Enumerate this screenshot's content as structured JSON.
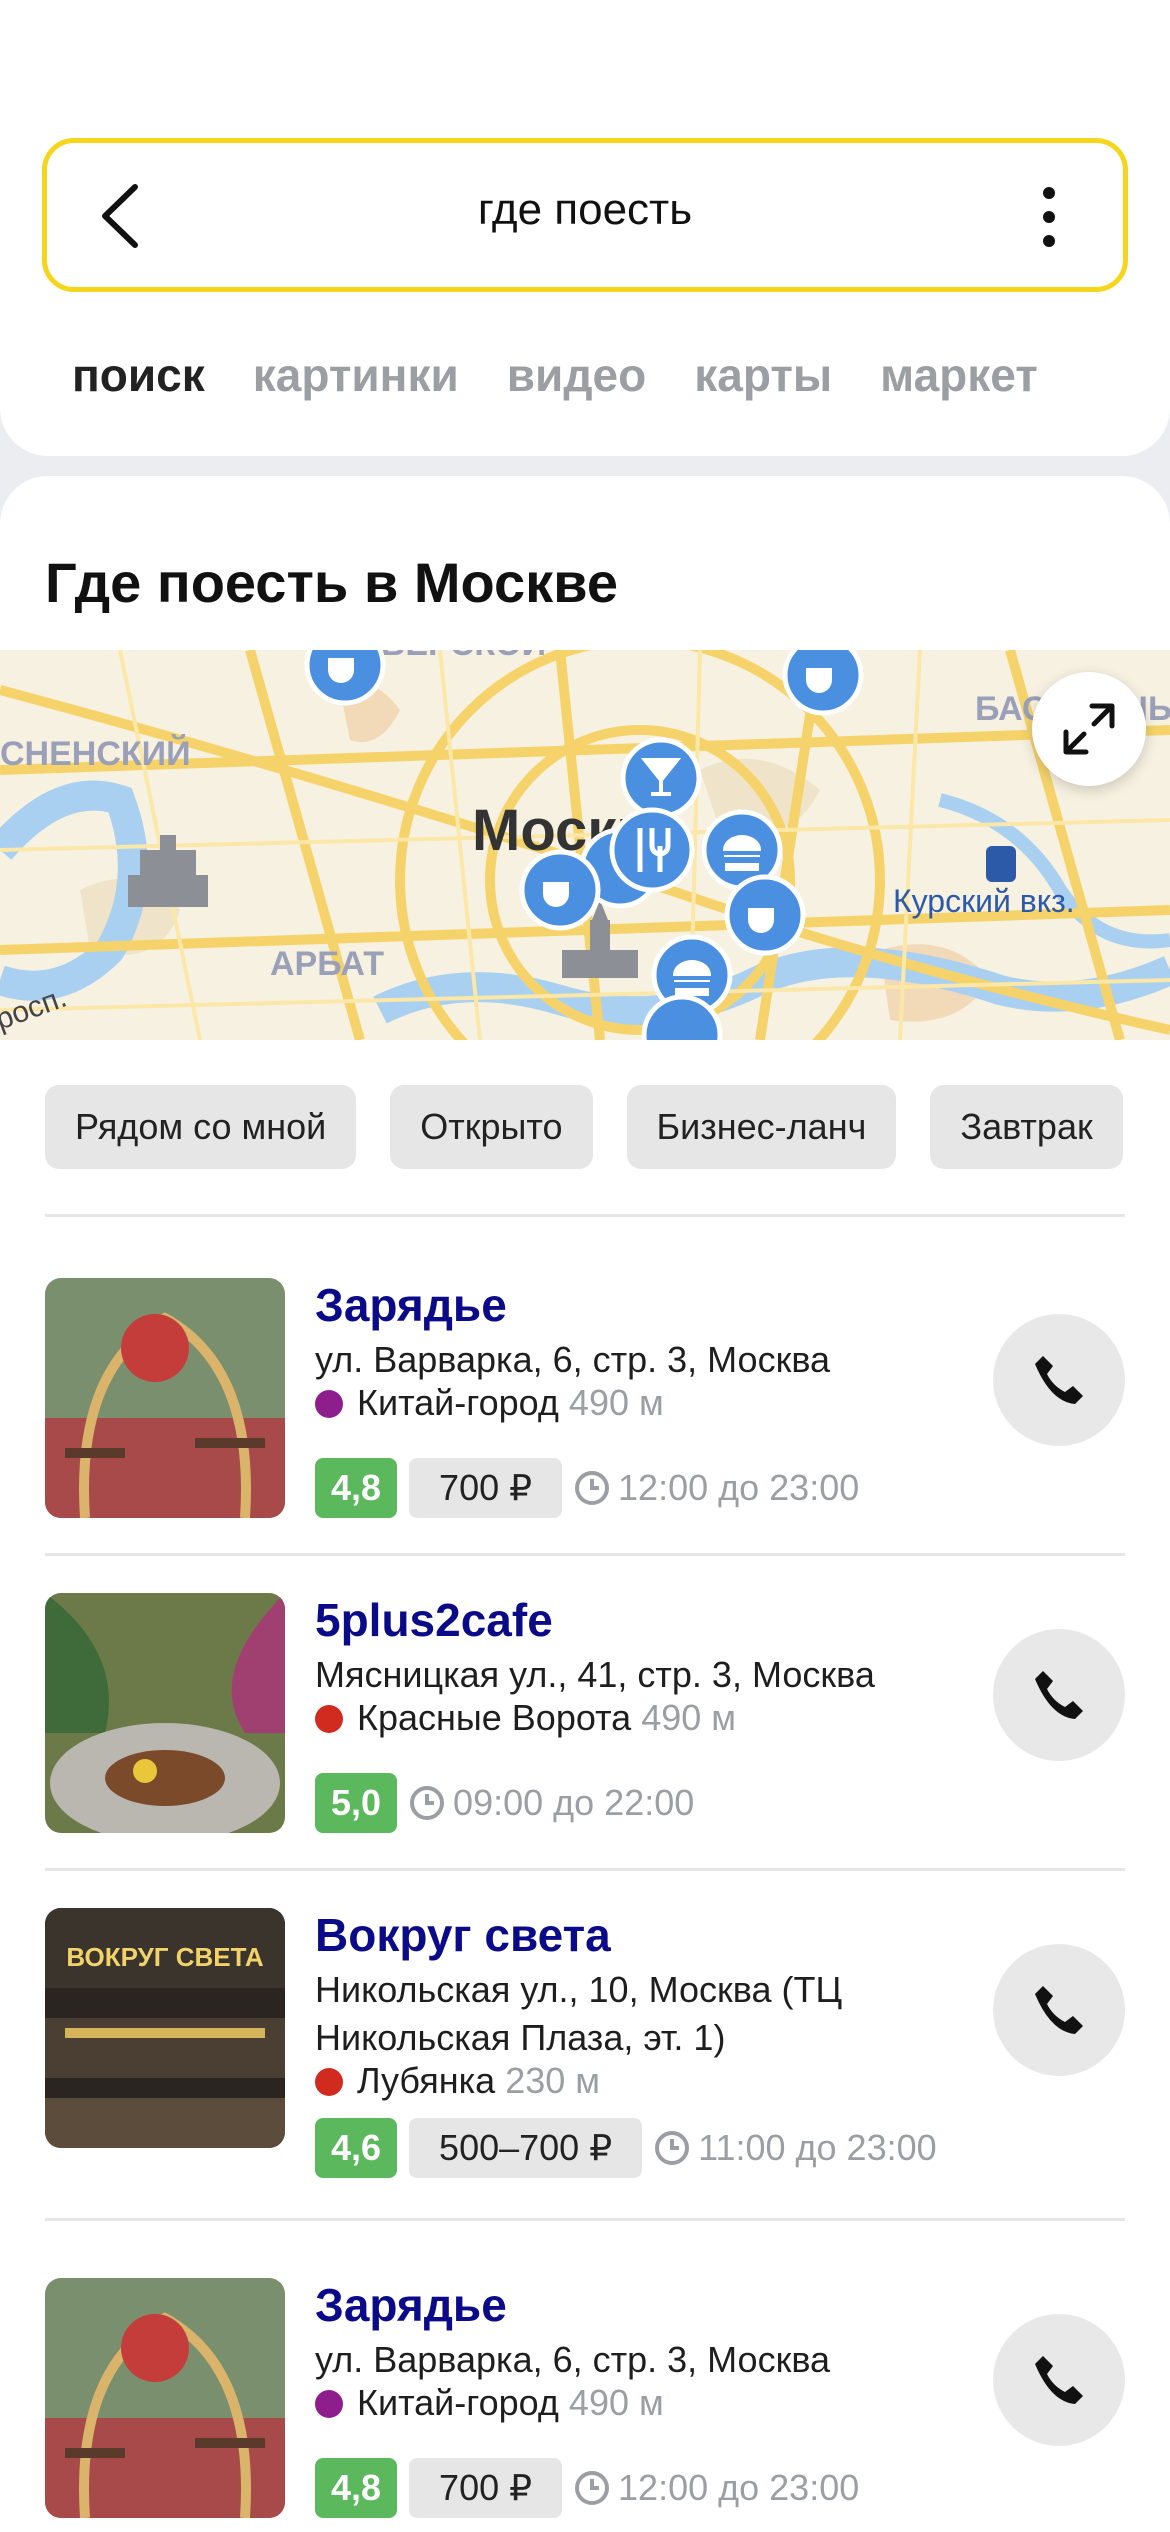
{
  "search": {
    "query": "где поесть"
  },
  "tabs": [
    {
      "label": "поиск",
      "active": true
    },
    {
      "label": "картинки"
    },
    {
      "label": "видео"
    },
    {
      "label": "карты"
    },
    {
      "label": "маркет"
    }
  ],
  "section": {
    "title": "Где поесть в Москве"
  },
  "map": {
    "labels": {
      "district_1": "СНЕНСКИЙ",
      "district_2": "АРБАТ",
      "district_3": "БАСМАННЫ",
      "district_4": "ТВЕРСКОЙ",
      "city": "Москва",
      "station": "Курский вкз.",
      "avenue": "росп."
    }
  },
  "filters": [
    "Рядом со мной",
    "Открыто",
    "Бизнес-ланч",
    "Завтрак"
  ],
  "colors": {
    "accent_yellow": "#f6d61a",
    "link_blue": "#0b0b8a",
    "rating_green": "#5cb85c",
    "metro_purple": "#8e1e8c",
    "metro_red": "#d12a1f",
    "map_pin": "#4b8fe0"
  },
  "results": [
    {
      "name": "Зарядье",
      "address": "ул. Варварка, 6, стр. 3, Москва",
      "metro": "Китай-город",
      "metro_color": "purple",
      "distance": "490 м",
      "rating": "4,8",
      "price": "700 ₽",
      "hours": "12:00 до 23:00",
      "icon": "phone-icon"
    },
    {
      "name": "5plus2cafe",
      "address": "Мясницкая ул., 41, стр. 3, Москва",
      "metro": "Красные Ворота",
      "metro_color": "red",
      "distance": "490 м",
      "rating": "5,0",
      "hours": "09:00 до 22:00",
      "icon": "phone-icon"
    },
    {
      "name": "Вокруг света",
      "address": "Никольская ул., 10, Москва (ТЦ Никольская Плаза, эт. 1)",
      "metro": "Лубянка",
      "metro_color": "red",
      "distance": "230 м",
      "rating": "4,6",
      "price": "500–700 ₽",
      "hours": "11:00 до 23:00",
      "photo_sign": "ВОКРУГ СВЕТА",
      "icon": "phone-icon"
    },
    {
      "name": "Зарядье",
      "address": "ул. Варварка, 6, стр. 3, Москва",
      "metro": "Китай-город",
      "metro_color": "purple",
      "distance": "490 м",
      "rating": "4,8",
      "price": "700 ₽",
      "hours": "12:00 до 23:00",
      "icon": "phone-icon"
    }
  ]
}
